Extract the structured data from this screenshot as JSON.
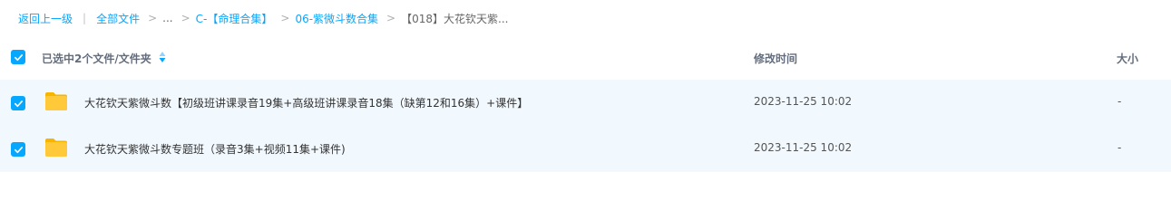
{
  "breadcrumb": {
    "back": "返回上一级",
    "all_files": "全部文件",
    "ellipsis": "...",
    "crumb1": "C-【命理合集】",
    "crumb2": "06-紫微斗数合集",
    "current": "【018】大花钦天紫..."
  },
  "header": {
    "selected_label": "已选中2个文件/文件夹",
    "time_label": "修改时间",
    "size_label": "大小"
  },
  "files": [
    {
      "name": "大花钦天紫微斗数【初级班讲课录音19集+高级班讲课录音18集（缺第12和16集）+课件】",
      "modified": "2023-11-25 10:02",
      "size": "-",
      "checked": true
    },
    {
      "name": "大花钦天紫微斗数专题班（录音3集+视频11集+课件)",
      "modified": "2023-11-25 10:02",
      "size": "-",
      "checked": true
    }
  ],
  "colors": {
    "accent": "#06a7ff",
    "row_selected_bg": "#f1f8fe",
    "folder": "#ffc93a"
  }
}
